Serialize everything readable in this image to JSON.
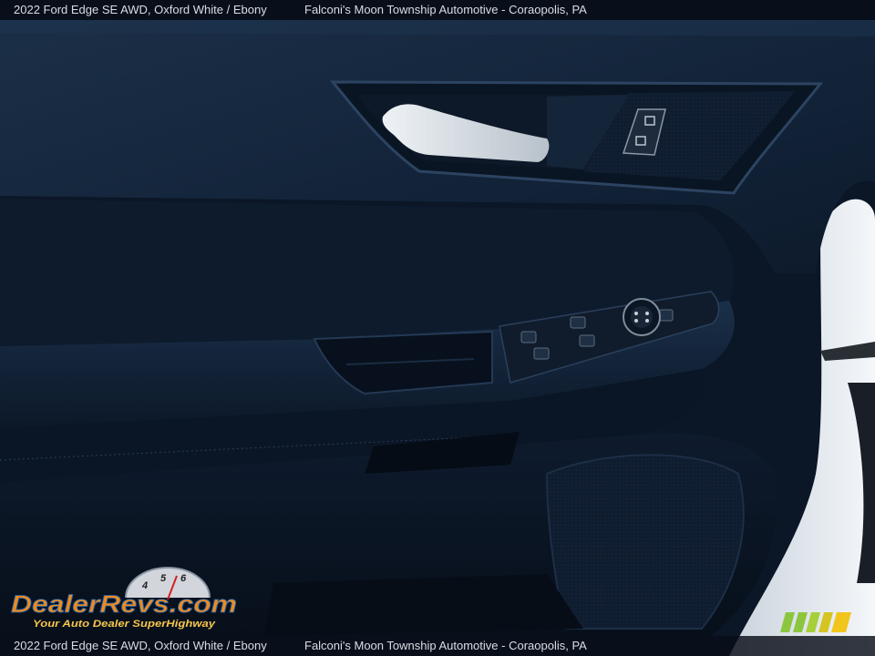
{
  "caption": {
    "vehicle": "2022 Ford Edge SE AWD,  Oxford White / Ebony",
    "dealer": "Falconi's Moon Township Automotive - Coraopolis, PA"
  },
  "watermark": {
    "logo_text": "DealerRevs.com",
    "tagline": "Your Auto Dealer SuperHighway",
    "gauge_digits": [
      "4",
      "5",
      "6"
    ]
  },
  "colors": {
    "door_panel": "#0f1c2e",
    "door_edge": "#e8edf2",
    "handle": "#d7dde3",
    "logo_orange": "#f08a1c",
    "logo_blue": "#1a64b4",
    "brand_green": "#8cc63f",
    "brand_yellow": "#f2c51b"
  },
  "icons": [
    "lock-icon",
    "mirror-knob-icon",
    "window-switch-icon"
  ]
}
